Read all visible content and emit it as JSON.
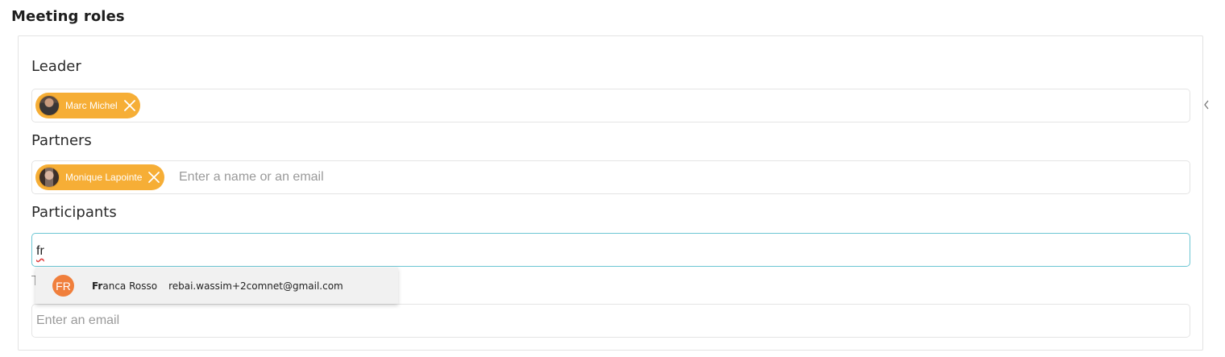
{
  "section": {
    "title": "Meeting roles"
  },
  "fields": {
    "leader": {
      "label": "Leader",
      "chips": [
        {
          "name": "Marc Michel"
        }
      ]
    },
    "partners": {
      "label": "Partners",
      "chips": [
        {
          "name": "Monique Lapointe"
        }
      ],
      "placeholder": "Enter a name or an email"
    },
    "participants": {
      "label": "Participants",
      "value": "fr"
    },
    "fourth": {
      "placeholder": "Enter an email"
    }
  },
  "suggestions": [
    {
      "initials": "FR",
      "name_match": "Fr",
      "name_rest": "anca Rosso",
      "email": "rebai.wassim+2comnet@gmail.com"
    }
  ],
  "colors": {
    "chip": "#f6ae36",
    "focus_border": "#6cc6d3",
    "initials_avatar": "#f07f3c",
    "dropdown_bg": "#f1f1f1"
  },
  "icons": {
    "chip_remove": "close-icon",
    "side_toggle": "chevron-left-icon"
  }
}
